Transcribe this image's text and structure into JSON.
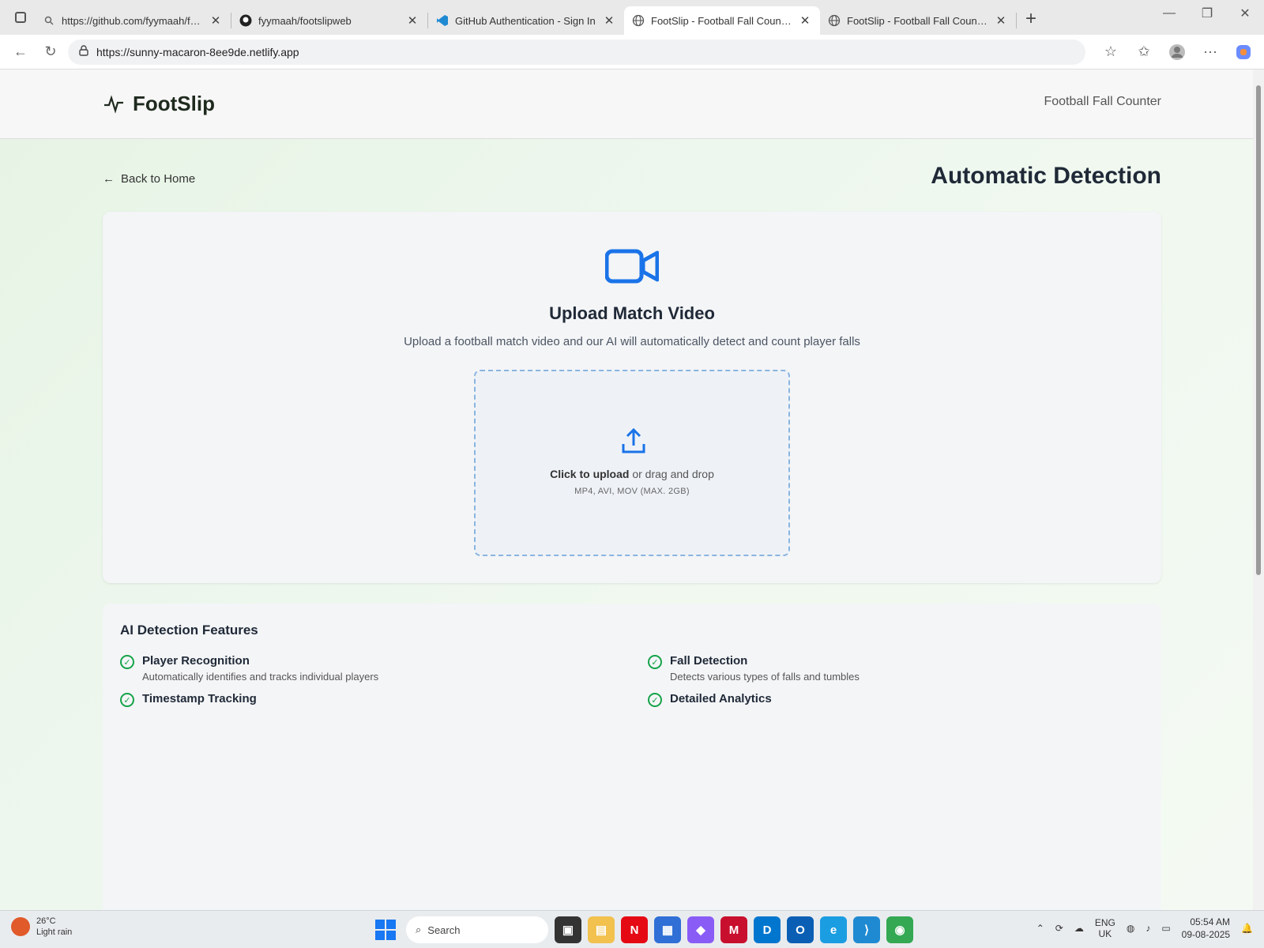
{
  "browser": {
    "tabs": [
      {
        "title": "https://github.com/fyymaah/foot",
        "icon": "search-icon",
        "active": false
      },
      {
        "title": "fyymaah/footslipweb",
        "icon": "github-icon",
        "active": false
      },
      {
        "title": "GitHub Authentication - Sign In",
        "icon": "vscode-icon",
        "active": false
      },
      {
        "title": "FootSlip - Football Fall Counter",
        "icon": "globe-icon",
        "active": true
      },
      {
        "title": "FootSlip - Football Fall Counter",
        "icon": "globe-icon",
        "active": false
      }
    ],
    "url": "https://sunny-macaron-8ee9de.netlify.app"
  },
  "site": {
    "logo": "FootSlip",
    "header_right": "Football Fall Counter",
    "back": "Back to Home",
    "heading": "Automatic Detection"
  },
  "upload": {
    "title": "Upload Match Video",
    "subtitle": "Upload a football match video and our AI will automatically detect and count player falls",
    "click": "Click to upload",
    "drag": "or drag and drop",
    "formats": "MP4, AVI, MOV (MAX. 2GB)",
    "accent": "#1a73e8"
  },
  "features": {
    "title": "AI Detection Features",
    "items": [
      {
        "title": "Player Recognition",
        "desc": "Automatically identifies and tracks individual players"
      },
      {
        "title": "Fall Detection",
        "desc": "Detects various types of falls and tumbles"
      },
      {
        "title": "Timestamp Tracking",
        "desc": ""
      },
      {
        "title": "Detailed Analytics",
        "desc": ""
      }
    ]
  },
  "taskbar": {
    "weather_temp": "26°C",
    "weather_desc": "Light rain",
    "search": "Search",
    "lang1": "ENG",
    "lang2": "UK",
    "time": "05:54 AM",
    "date": "09-08-2025"
  }
}
